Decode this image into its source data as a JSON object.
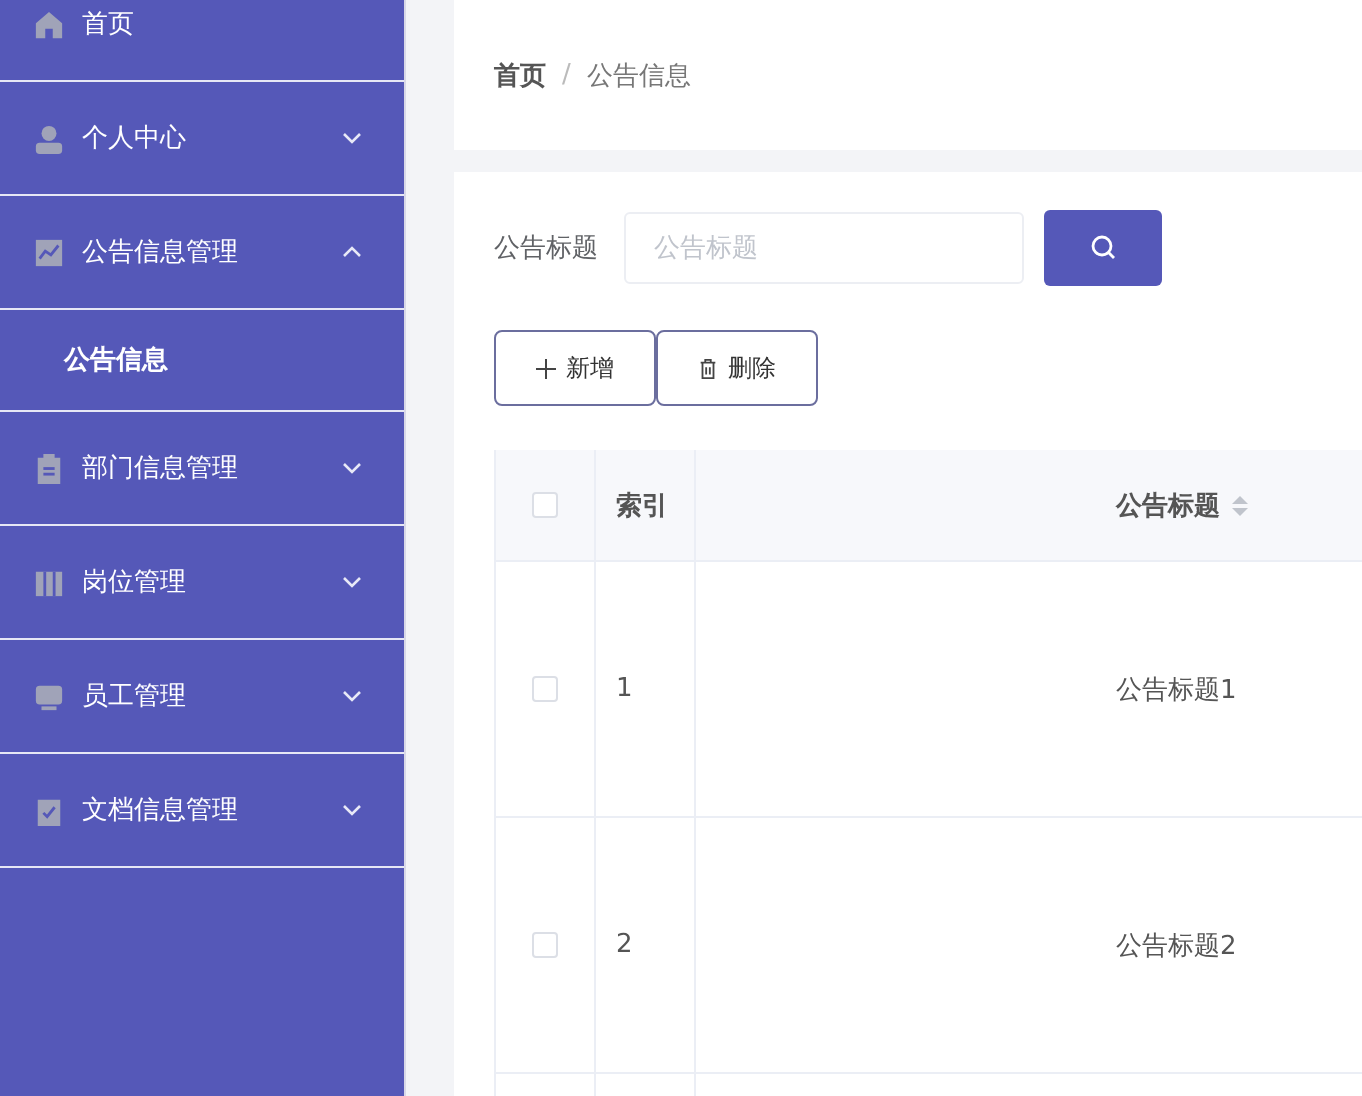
{
  "sidebar": {
    "items": [
      {
        "label": "首页"
      },
      {
        "label": "个人中心",
        "expanded": false
      },
      {
        "label": "公告信息管理",
        "expanded": true,
        "children": [
          {
            "label": "公告信息",
            "selected": true
          }
        ]
      },
      {
        "label": "部门信息管理",
        "expanded": false
      },
      {
        "label": "岗位管理",
        "expanded": false
      },
      {
        "label": "员工管理",
        "expanded": false
      },
      {
        "label": "文档信息管理",
        "expanded": false
      }
    ]
  },
  "breadcrumb": [
    "首页",
    "公告信息"
  ],
  "breadcrumb_separator": "/",
  "search": {
    "label": "公告标题",
    "placeholder": "公告标题"
  },
  "actions": [
    {
      "kind": "add",
      "label": "新增"
    },
    {
      "kind": "delete",
      "label": "删除"
    }
  ],
  "table": {
    "select_all_checked": false,
    "columns": [
      {
        "label": "索引",
        "sortable": false
      },
      {
        "label": "公告标题",
        "sortable": true
      }
    ],
    "rows": [
      {
        "checked": false,
        "cells": [
          "1",
          "公告标题1"
        ]
      },
      {
        "checked": false,
        "cells": [
          "2",
          "公告标题2"
        ]
      }
    ]
  }
}
